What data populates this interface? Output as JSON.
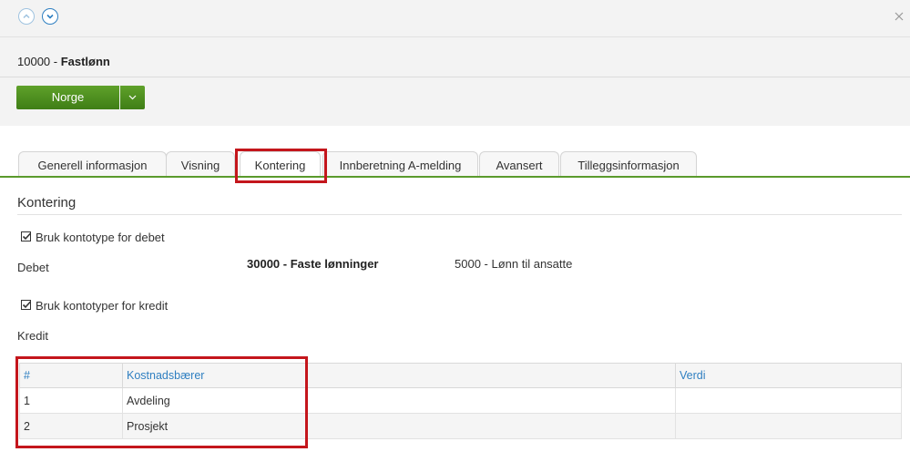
{
  "header": {
    "nav_up_icon": "chevron-up-icon",
    "nav_down_icon": "chevron-down-icon",
    "close_symbol": "×"
  },
  "record": {
    "number_prefix": "10000 - ",
    "name": "Fastlønn"
  },
  "country_button": {
    "label": "Norge",
    "toggle_icon": "chevron-down-icon",
    "color": "#4f9222"
  },
  "tabs": [
    {
      "label": "Generell informasjon",
      "active": false
    },
    {
      "label": "Visning",
      "active": false
    },
    {
      "label": "Kontering",
      "active": true
    },
    {
      "label": "Innberetning A-melding",
      "active": false
    },
    {
      "label": "Avansert",
      "active": false
    },
    {
      "label": "Tilleggsinformasjon",
      "active": false
    }
  ],
  "section": {
    "title": "Kontering",
    "debet_checkbox": {
      "label": "Bruk kontotype for debet",
      "checked": true
    },
    "debet_label": "Debet",
    "debet_account": "30000 - Faste lønninger",
    "debet_description": "5000 - Lønn til ansatte",
    "kredit_checkbox": {
      "label": "Bruk kontotyper for kredit",
      "checked": true
    },
    "kredit_label": "Kredit"
  },
  "table": {
    "headers": [
      "#",
      "Kostnadsbærer",
      "Verdi"
    ],
    "rows": [
      [
        "1",
        "Avdeling",
        ""
      ],
      [
        "2",
        "Prosjekt",
        ""
      ]
    ]
  },
  "colors": {
    "accent_blue": "#2f7fc1",
    "highlight_red": "#c4161c",
    "tab_underline_green": "#5a9a2c"
  }
}
